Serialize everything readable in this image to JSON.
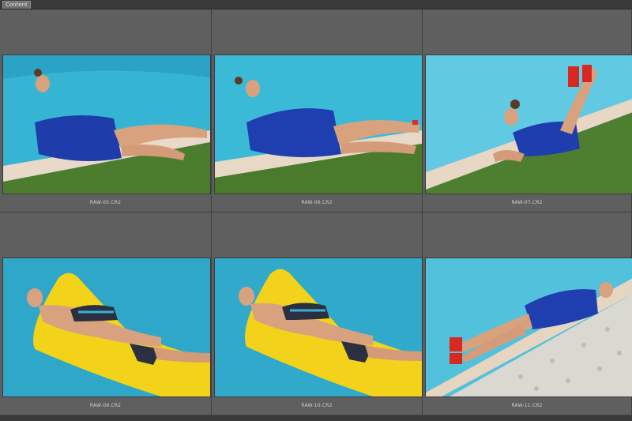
{
  "tab": {
    "label": "Content"
  },
  "grid": {
    "cells": [
      {
        "filename": "RAW-05.CR2"
      },
      {
        "filename": "RAW-06.CR2"
      },
      {
        "filename": "RAW-07.CR2"
      },
      {
        "filename": "RAW-09.CR2"
      },
      {
        "filename": "RAW-10.CR2"
      },
      {
        "filename": "RAW-11.CR2"
      }
    ]
  },
  "colors": {
    "pool_blue": "#37b7d6",
    "grass": "#4a7a2e",
    "dress": "#1f3fb0",
    "float_yellow": "#f2d21b",
    "gravel": "#d8d8d2"
  }
}
